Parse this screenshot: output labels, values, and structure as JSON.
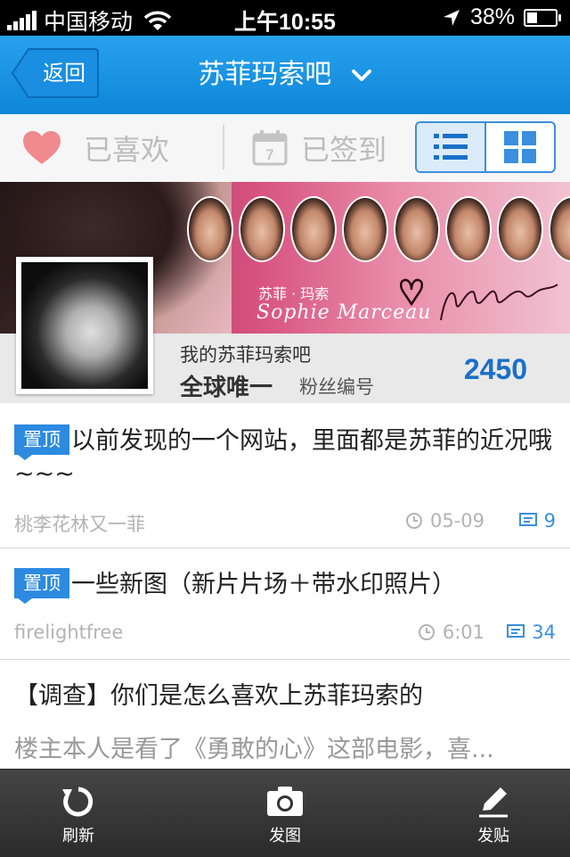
{
  "status_bar": {
    "carrier": "中国移动",
    "time": "上午10:55",
    "battery": "38%",
    "battery_level": 0.38
  },
  "nav": {
    "back_label": "返回",
    "title": "苏菲玛索吧",
    "dropdown_icon": "chevron-down-icon"
  },
  "action_bar": {
    "liked_label": "已喜欢",
    "signed_label": "已签到",
    "calendar_day": "7",
    "view_modes": [
      "list-view-icon",
      "grid-view-icon"
    ],
    "active_view": "list"
  },
  "banner": {
    "name_cn": "苏菲 · 玛索",
    "name_en": "Sophie Marceau"
  },
  "forum_info": {
    "bar_label": "我的苏菲玛索吧",
    "unique_label": "全球唯一",
    "fan_label": "粉丝编号",
    "fan_number": "2450"
  },
  "posts": [
    {
      "pinned_tag": "置顶",
      "title": "以前发现的一个网站，里面都是苏菲的近况哦~~~",
      "author": "桃李花林又一菲",
      "time": "05-09",
      "comments": "9"
    },
    {
      "pinned_tag": "置顶",
      "title": "一些新图（新片片场＋带水印照片）",
      "author": "firelightfree",
      "time": "6:01",
      "comments": "34"
    },
    {
      "title": "【调查】你们是怎么喜欢上苏菲玛索的",
      "snippet": "楼主本人是看了《勇敢的心》这部电影，喜..."
    }
  ],
  "tab_bar": {
    "refresh": "刷新",
    "photo": "发图",
    "post": "发贴"
  },
  "colors": {
    "nav_blue": "#1592e4",
    "accent_blue": "#2c8ae0",
    "heart_pink": "#f08a8e"
  }
}
